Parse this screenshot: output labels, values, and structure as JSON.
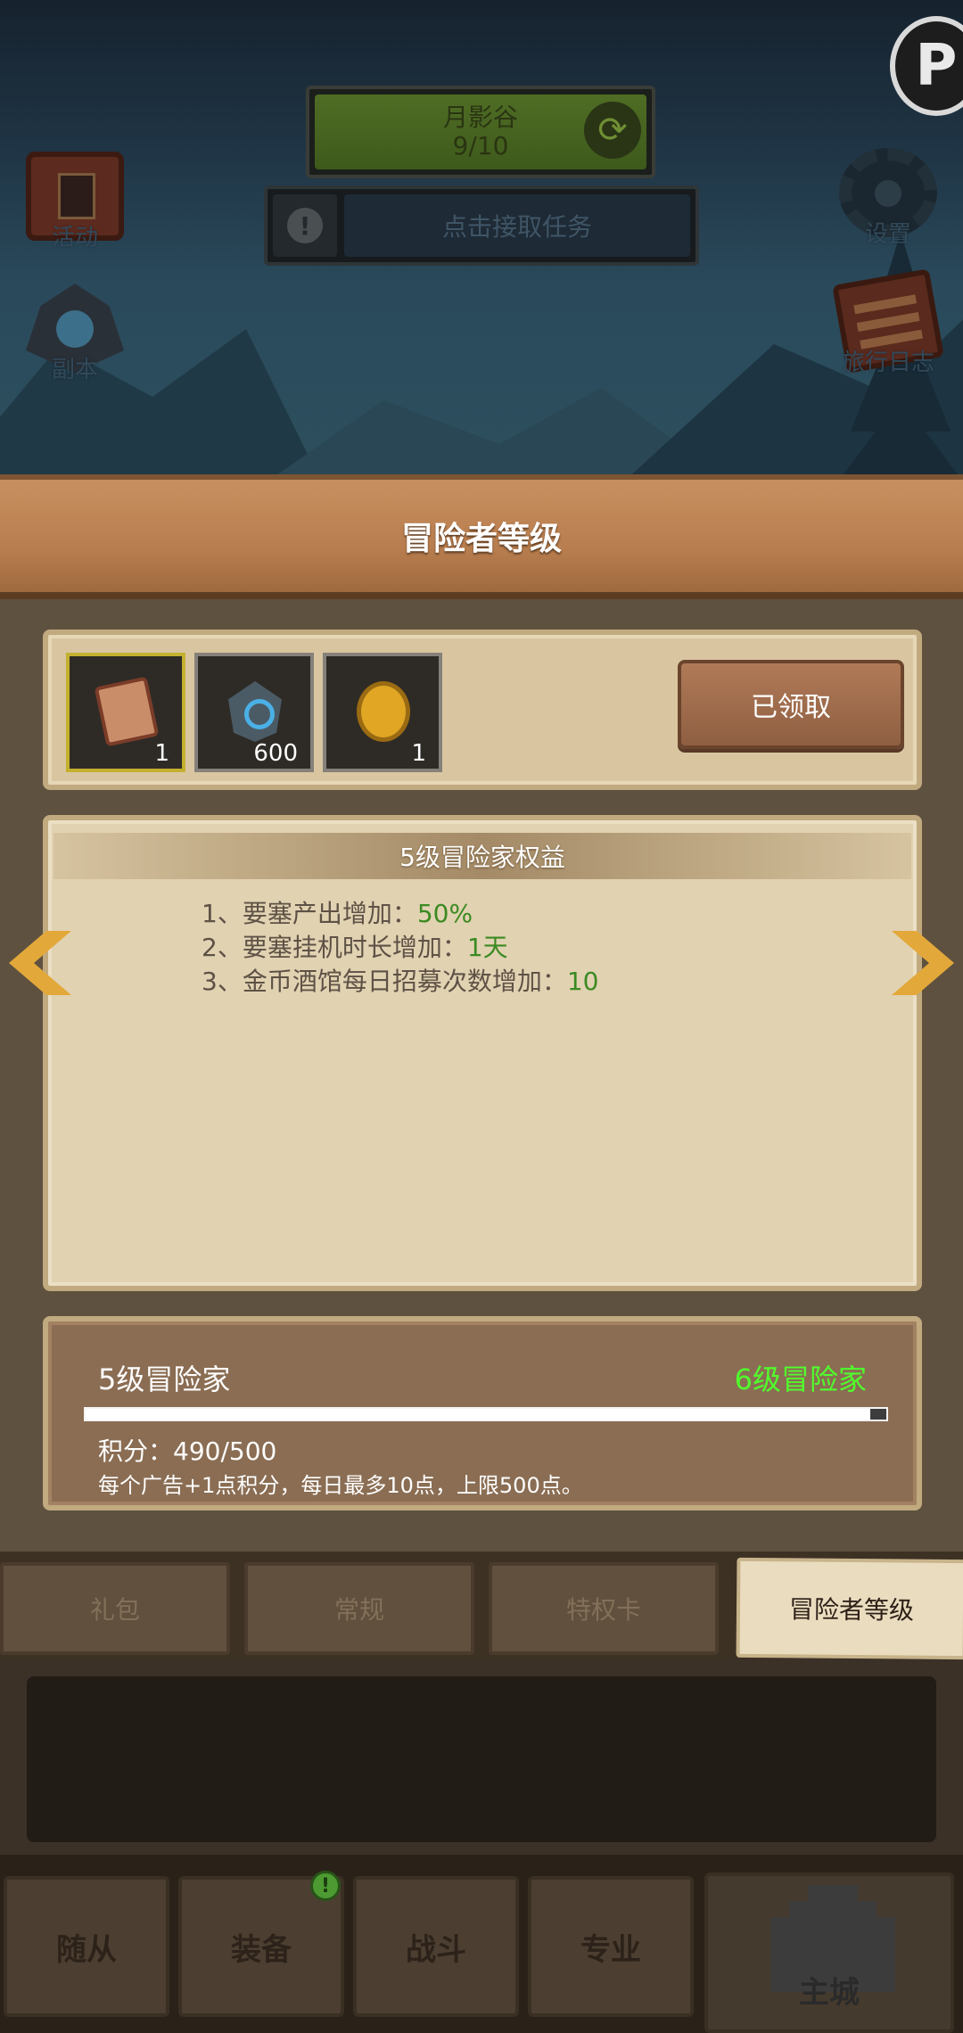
{
  "top": {
    "zone_name": "月影谷",
    "zone_progress": "9/10",
    "task_prompt": "点击接取任务",
    "side_left": [
      {
        "label": "活动",
        "icon": "activity-scroll-icon"
      },
      {
        "label": "副本",
        "icon": "dungeon-portal-icon"
      }
    ],
    "side_right": [
      {
        "label": "设置",
        "icon": "gear-icon"
      },
      {
        "label": "旅行日志",
        "icon": "journal-book-icon"
      }
    ],
    "corner_glyph": "P"
  },
  "panel": {
    "title": "冒险者等级",
    "rewards": [
      {
        "icon": "skill-book-icon",
        "qty": "1"
      },
      {
        "icon": "rune-stone-icon",
        "qty": "600"
      },
      {
        "icon": "gold-coin-icon",
        "qty": "1"
      }
    ],
    "claim_label": "已领取",
    "benefit_title": "5级冒险家权益",
    "benefits": [
      {
        "text": "1、要塞产出增加：",
        "value": "50%"
      },
      {
        "text": "2、要塞挂机时长增加：",
        "value": "1天"
      },
      {
        "text": "3、金币酒馆每日招募次数增加：",
        "value": "10"
      }
    ],
    "level_current": "5级冒险家",
    "level_next": "6级冒险家",
    "progress": 0.98,
    "score_text": "积分：490/500",
    "hint_text": "每个广告+1点积分，每日最多10点，上限500点。"
  },
  "tabs": [
    {
      "label": "礼包",
      "active": false
    },
    {
      "label": "常规",
      "active": false
    },
    {
      "label": "特权卡",
      "active": false
    },
    {
      "label": "冒险者等级",
      "active": true
    }
  ],
  "bottom_nav": [
    {
      "label": "随从"
    },
    {
      "label": "装备",
      "badge": "!"
    },
    {
      "label": "战斗"
    },
    {
      "label": "专业"
    },
    {
      "label": "主城"
    }
  ],
  "colors": {
    "benefit_value": "#3b8a22",
    "next_level": "#50ff2c",
    "panel_title_bg": "#b97e4f"
  }
}
